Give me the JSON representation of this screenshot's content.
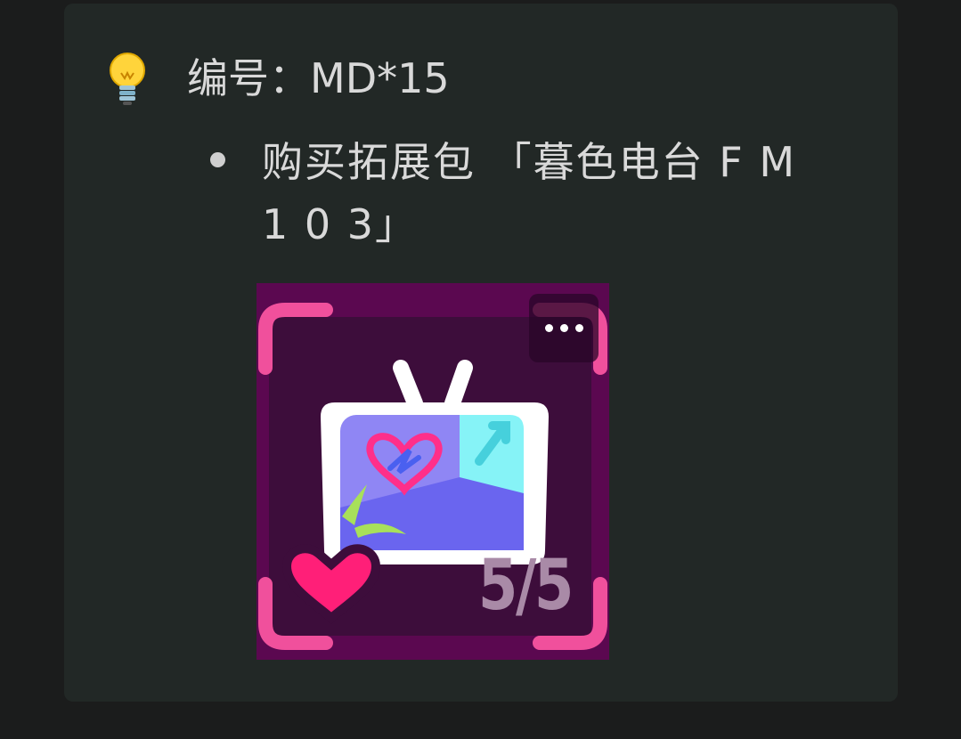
{
  "note": {
    "icon": "lightbulb-icon",
    "label": "编号：MD*15"
  },
  "item": {
    "text": "购买拓展包 「暮色电台 F M 1 0 3」"
  },
  "card": {
    "counter": "5/5",
    "more_icon": "more-dots-icon",
    "art_icon": "tv-icon",
    "badge_icon": "heart-icon"
  },
  "colors": {
    "page_background": "#1b1c1c",
    "card_background": "#222826",
    "text": "#d9d9d9",
    "tile_background": "#5b0850",
    "frame_pink": "#f0509c",
    "heart_pink": "#ff1f78",
    "counter_text": "#a98aa7"
  }
}
